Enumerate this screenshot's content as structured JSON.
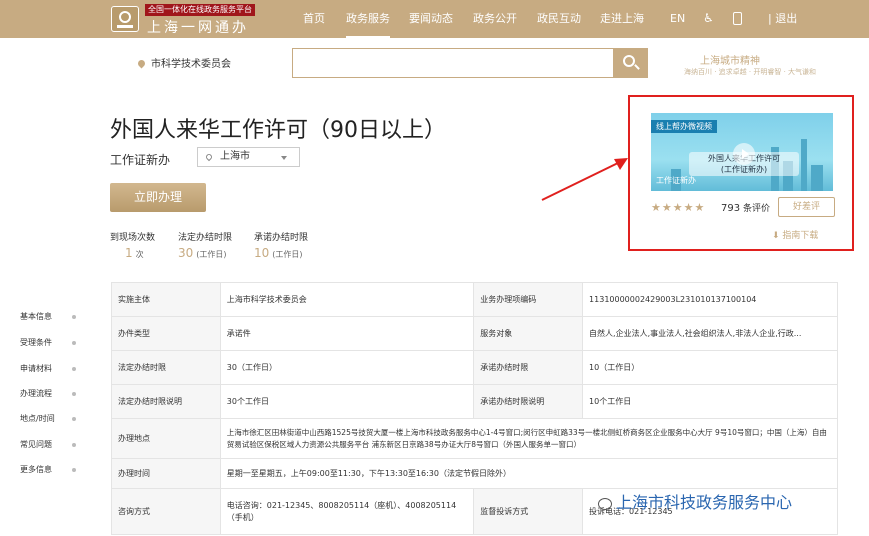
{
  "header": {
    "logo_sub": "全国一体化在线政务服务平台",
    "logo_title": "上海一网通办",
    "nav": [
      "首页",
      "政务服务",
      "要闻动态",
      "政务公开",
      "政民互动",
      "走进上海"
    ],
    "lang": "EN",
    "logout": "退出"
  },
  "search": {
    "location": "市科学技术委员会",
    "placeholder": ""
  },
  "spirit": {
    "title": "上海城市精神",
    "sub": "海纳百川 · 追求卓越 · 开明睿智 · 大气谦和"
  },
  "service": {
    "title": "外国人来华工作许可（90日以上）",
    "subtitle": "工作证新办",
    "city": "上海市",
    "apply": "立即办理"
  },
  "stats": [
    {
      "label": "到现场次数",
      "value": "1",
      "unit": "次"
    },
    {
      "label": "法定办结时限",
      "value": "30",
      "unit": "(工作日)"
    },
    {
      "label": "承诺办结时限",
      "value": "10",
      "unit": "(工作日)"
    }
  ],
  "video": {
    "tag": "线上帮办微视频",
    "title1": "外国人来华工作许可",
    "title2": "(工作证新办)",
    "bottom": "工作证新办"
  },
  "rating": {
    "stars": "★★★★★",
    "count": "793",
    "count_label": "条评价",
    "good": "好差评",
    "guide": "指南下载",
    "value": 5
  },
  "sidebar": [
    "基本信息",
    "受理条件",
    "申请材料",
    "办理流程",
    "地点/时间",
    "常见问题",
    "更多信息"
  ],
  "table": {
    "r1": [
      "实施主体",
      "上海市科学技术委员会",
      "业务办理项编码",
      "11310000002429003L231010137100104"
    ],
    "r2": [
      "办件类型",
      "承诺件",
      "服务对象",
      "自然人,企业法人,事业法人,社会组织法人,非法人企业,行政..."
    ],
    "r3": [
      "法定办结时限",
      "30（工作日）",
      "承诺办结时限",
      "10（工作日）"
    ],
    "r4": [
      "法定办结时限说明",
      "30个工作日",
      "承诺办结时限说明",
      "10个工作日"
    ],
    "r5": [
      "办理地点",
      "上海市徐汇区田林街道中山西路1525号技贸大厦一楼上海市科技政务服务中心1-4号窗口;闵行区申虹路33号一楼北侧虹桥商务区企业服务中心大厅 9号10号窗口；中国（上海）自由贸易试验区保税区域人力资源公共服务平台 浦东新区日京路38号办证大厅8号窗口（外国人服务单一窗口）"
    ],
    "r6": [
      "办理时间",
      "星期一至星期五，上午09:00至11:30，下午13:30至16:30（法定节假日除外）"
    ],
    "r7": [
      "咨询方式",
      "电话咨询：021-12345、8008205114（座机）、4008205114（手机）",
      "监督投诉方式",
      "投诉电话：021-12345"
    ]
  },
  "watermark": "上海市科技政务服务中心"
}
